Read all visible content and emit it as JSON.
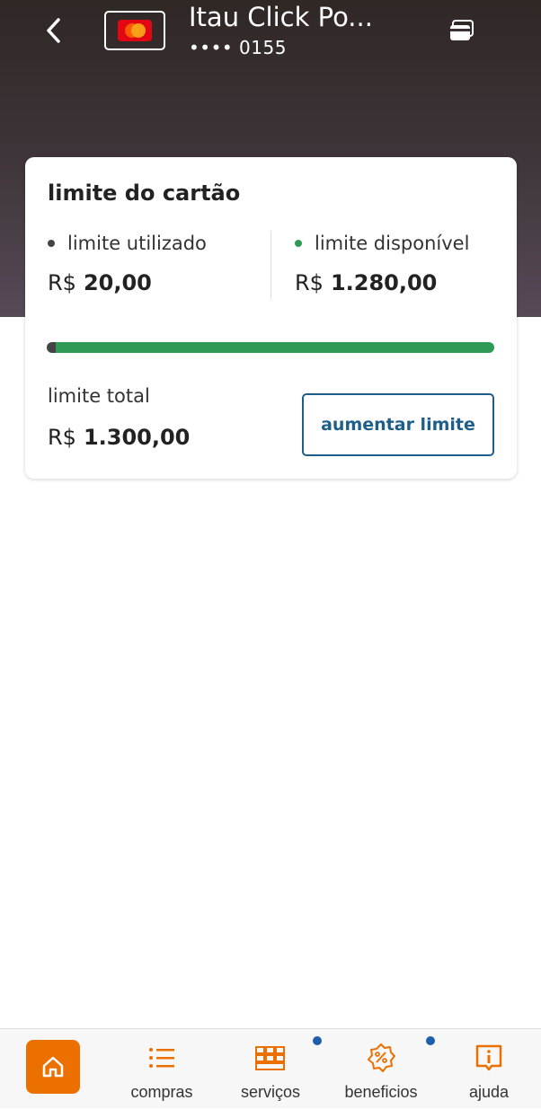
{
  "header": {
    "title": "Itau Click Po...",
    "card_number": "•••• 0155",
    "back_icon": "chevron-left-icon",
    "card_brand_icon": "mastercard-icon",
    "cards_icon": "cards-stack-icon"
  },
  "limit_card": {
    "title": "limite do cartão",
    "used": {
      "label": "limite utilizado",
      "currency": "R$",
      "amount": "20,00",
      "dot_color": "#444444"
    },
    "available": {
      "label": "limite disponível",
      "currency": "R$",
      "amount": "1.280,00",
      "dot_color": "#2e9a55"
    },
    "used_fraction": 0.0154,
    "total": {
      "label": "limite total",
      "currency": "R$",
      "amount": "1.300,00"
    },
    "increase_button": "aumentar limite"
  },
  "bottom_nav": {
    "items": [
      {
        "label": "",
        "icon": "home-icon",
        "active": true
      },
      {
        "label": "compras",
        "icon": "list-icon"
      },
      {
        "label": "serviços",
        "icon": "grid-icon",
        "badge": true
      },
      {
        "label": "beneficios",
        "icon": "discount-badge-icon",
        "badge": true
      },
      {
        "label": "ajuda",
        "icon": "info-icon"
      }
    ]
  },
  "colors": {
    "accent": "#ec7000",
    "link_blue": "#1d5f8a",
    "available_green": "#2e9a55",
    "badge_blue": "#1f5ea8"
  }
}
